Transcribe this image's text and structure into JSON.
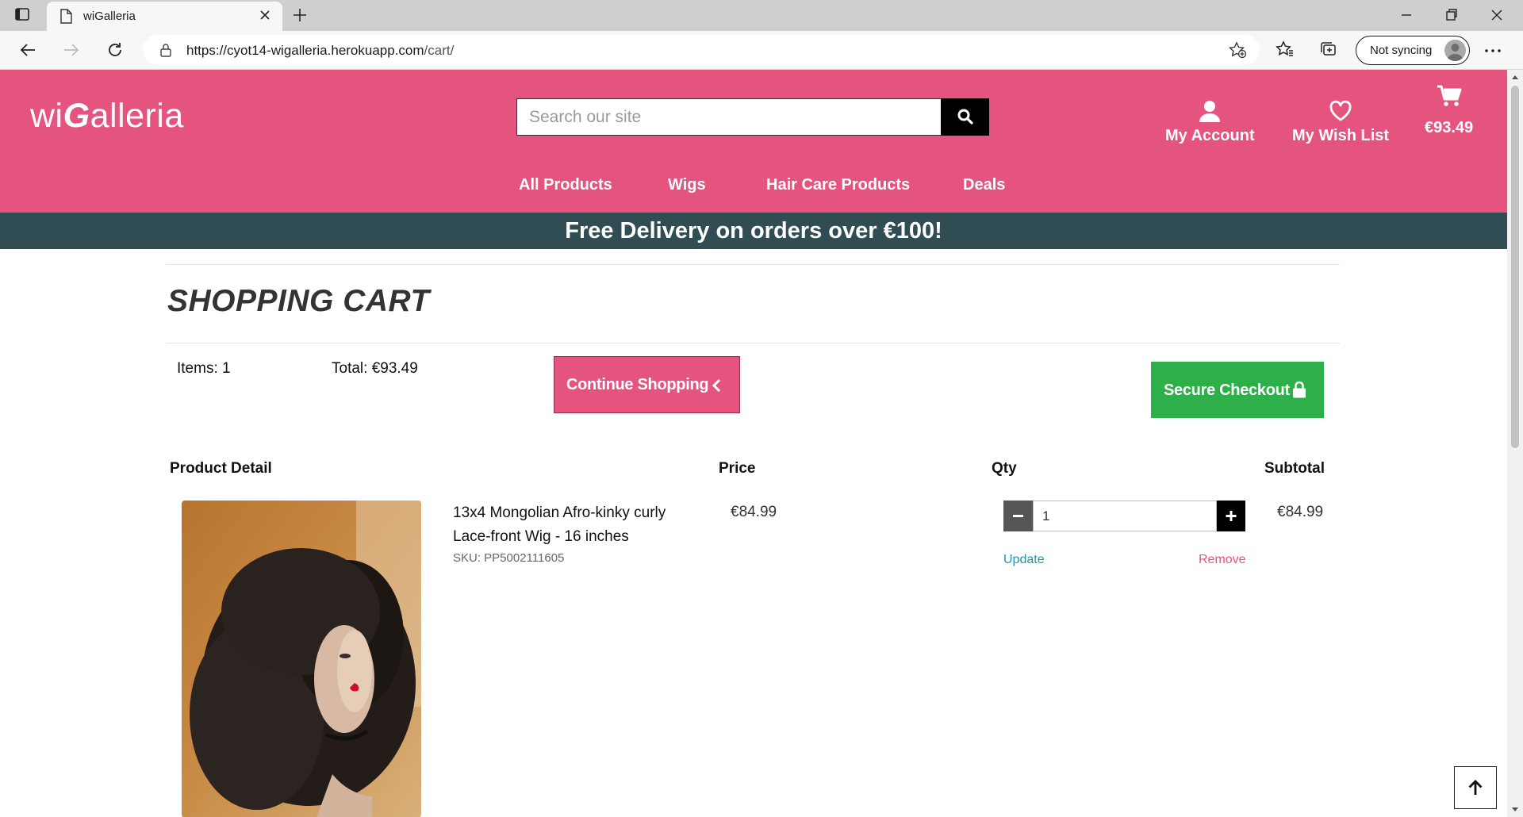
{
  "browser": {
    "tab_title": "wiGalleria",
    "url_host": "https://cyot14-wigalleria.herokuapp.com",
    "url_path": "/cart/",
    "sync_label": "Not syncing"
  },
  "header": {
    "logo_start": "wi",
    "logo_g": "G",
    "logo_end": "alleria",
    "search_placeholder": "Search our site",
    "account_label": "My Account",
    "wishlist_label": "My Wish List",
    "cart_total": "€93.49",
    "nav": [
      "All Products",
      "Wigs",
      "Hair Care Products",
      "Deals"
    ]
  },
  "promo": "Free Delivery on orders over €100!",
  "cart": {
    "title": "SHOPPING CART",
    "items_label": "Items: 1",
    "total_label": "Total: €93.49",
    "continue_label": "Continue Shopping",
    "checkout_label": "Secure Checkout",
    "columns": [
      "Product Detail",
      "Price",
      "Qty",
      "Subtotal"
    ],
    "items": [
      {
        "name": "13x4 Mongolian Afro-kinky curly Lace-front Wig - 16 inches",
        "sku": "SKU: PP5002111605",
        "price": "€84.99",
        "qty": "1",
        "subtotal": "€84.99",
        "update_label": "Update",
        "remove_label": "Remove"
      }
    ]
  },
  "colors": {
    "brand_pink": "#e5547f",
    "promo_bg": "#2f4d52",
    "checkout_green": "#2daf4a",
    "update_link": "#1a98a8"
  }
}
